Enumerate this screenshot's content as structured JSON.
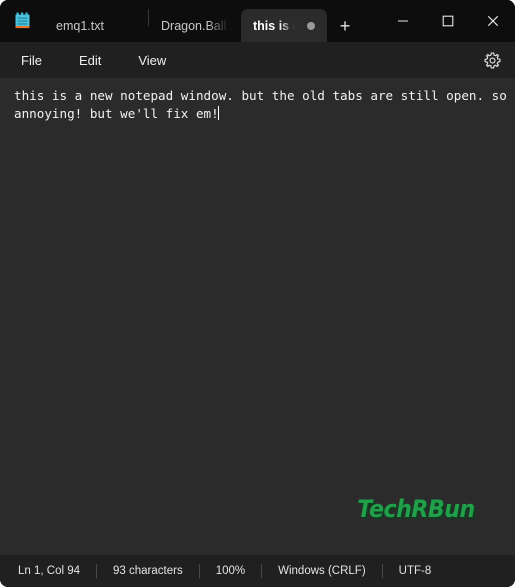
{
  "window": {
    "app_icon_name": "notepad-icon",
    "controls": {
      "minimize": "—",
      "maximize": "☐",
      "close": "✕"
    }
  },
  "tabs": {
    "items": [
      {
        "label": "emq1.txt",
        "active": false,
        "modified": false
      },
      {
        "label": "Dragon.Ball.S",
        "active": false,
        "modified": false
      },
      {
        "label": "this is a",
        "active": true,
        "modified": true
      }
    ],
    "new_tab_label": "+"
  },
  "menubar": {
    "items": [
      "File",
      "Edit",
      "View"
    ],
    "settings_icon": "gear-icon"
  },
  "editor": {
    "content": "this is a new notepad window. but the old tabs are still open. so annoying! but we'll fix em!"
  },
  "watermark": {
    "text": "TechRBun",
    "color": "#21a04a",
    "shadow_color": "#0f3d20"
  },
  "statusbar": {
    "cells": [
      "Ln 1, Col 94",
      "93 characters",
      "100%",
      "Windows (CRLF)",
      "UTF-8"
    ]
  },
  "colors": {
    "titlebar_bg": "#0d0d0d",
    "menubar_bg": "#202020",
    "editor_bg": "#2b2b2b",
    "statusbar_bg": "#202020",
    "text": "#f2f2f2"
  }
}
